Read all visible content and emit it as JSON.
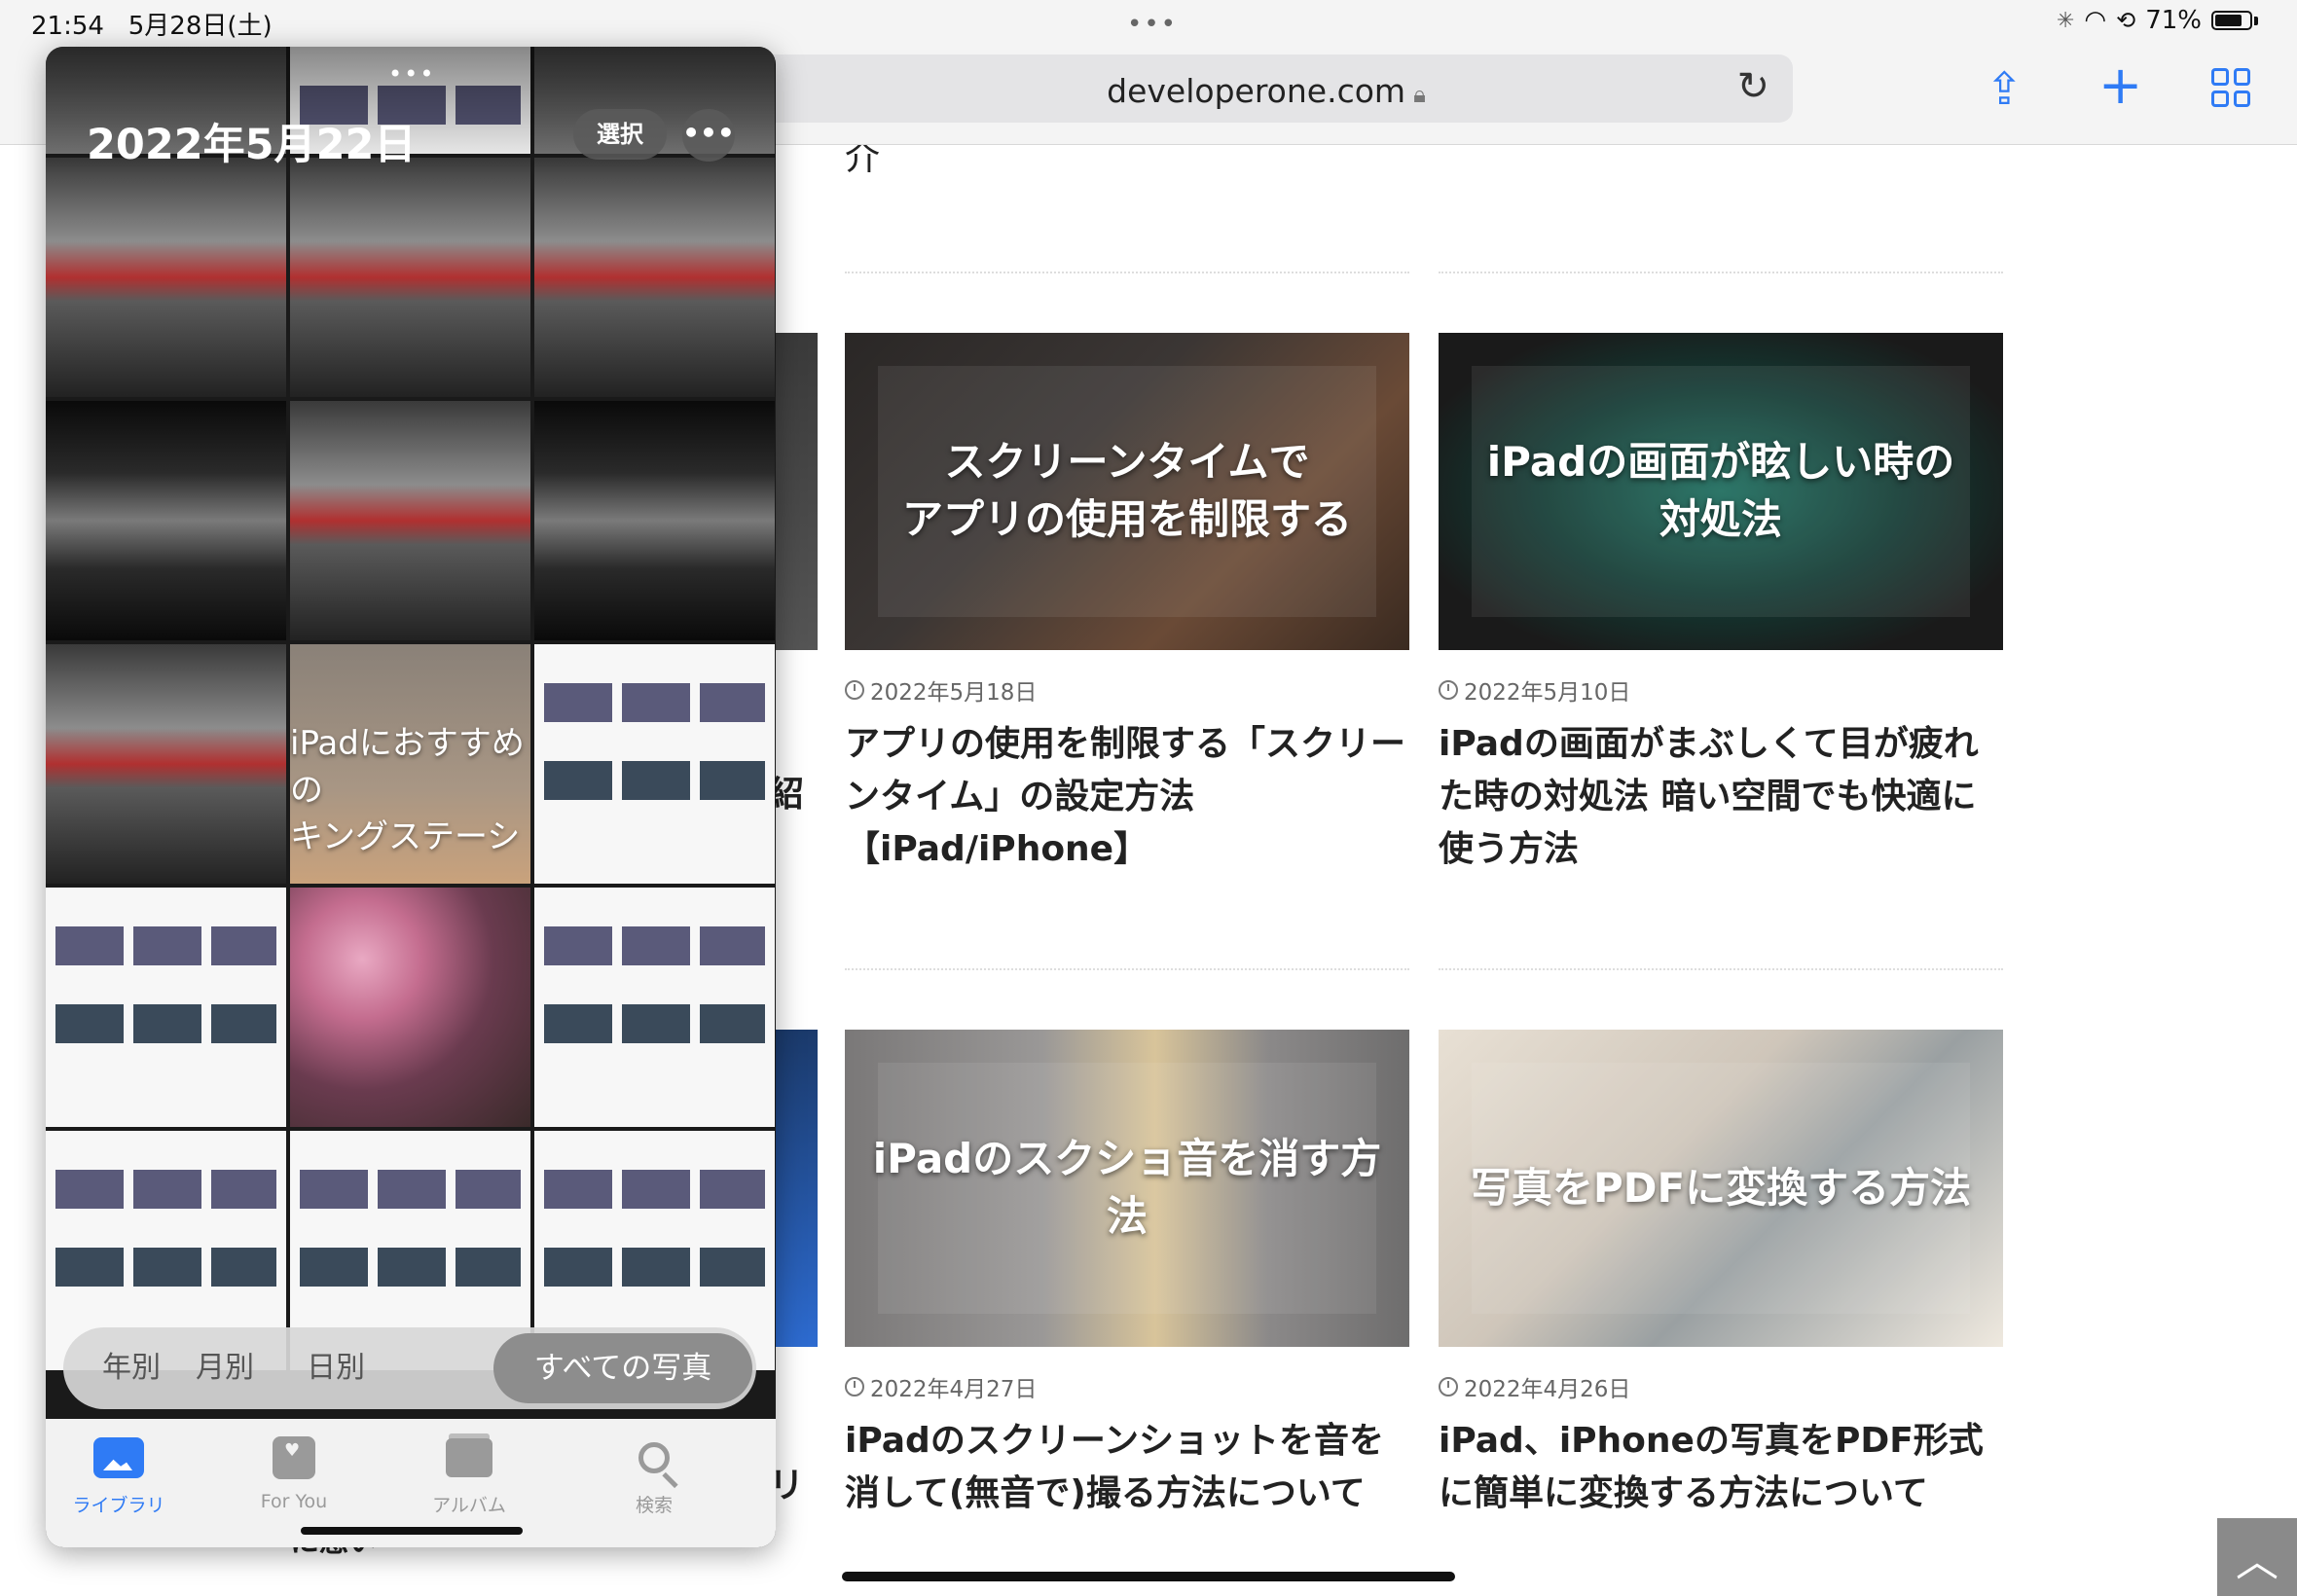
{
  "status_bar": {
    "time": "21:54",
    "date": "5月28日(土)",
    "battery": "71%",
    "battery_level": 0.71
  },
  "browser": {
    "url": "developerone.com",
    "icons": [
      "lock-icon",
      "reload-icon",
      "share-icon",
      "plus-icon",
      "tabs-icon"
    ]
  },
  "page": {
    "cut_text": "介",
    "peek_text_1": "紹",
    "peek_text_2": "リ",
    "peek_text_3": "に急い",
    "articles": [
      {
        "thumb_text": "スクリーンタイムで\nアプリの使用を制限する",
        "date": "2022年5月18日",
        "title": "アプリの使用を制限する「スクリーンタイム」の設定方法【iPad/iPhone】"
      },
      {
        "thumb_text": "iPadの画面が眩しい時の\n対処法",
        "date": "2022年5月10日",
        "title": "iPadの画面がまぶしくて目が疲れた時の対処法 暗い空間でも快適に使う方法"
      },
      {
        "thumb_text": "iPadのスクショ音を消す方法",
        "date": "2022年4月27日",
        "title": "iPadのスクリーンショットを音を消して(無音で)撮る方法について"
      },
      {
        "thumb_text": "写真をPDFに変換する方法",
        "date": "2022年4月26日",
        "title": "iPad、iPhoneの写真をPDF形式に簡単に変換する方法について"
      }
    ]
  },
  "photos": {
    "title": "2022年5月22日",
    "select_label": "選択",
    "more_label": "•••",
    "grid_caption": "iPadにおすすめの\nキングステーシ",
    "segments": {
      "year": "年別",
      "month": "月別",
      "day": "日別",
      "all": "すべての写真"
    },
    "tabs": {
      "library": "ライブラリ",
      "for_you": "For You",
      "albums": "アルバム",
      "search": "検索"
    }
  }
}
